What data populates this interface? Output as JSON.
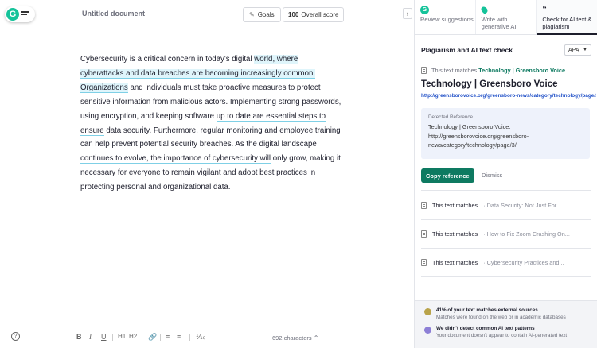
{
  "editor": {
    "doc_title": "Untitled document",
    "goals_label": "Goals",
    "score_value": "100",
    "score_label": "Overall score",
    "paragraph": [
      {
        "t": "Cybersecurity is a critical concern in today's digital ",
        "s": "n"
      },
      {
        "t": "world, where cyberattacks and data breaches are becoming increasingly common. Organizations",
        "s": "h"
      },
      {
        "t": " and individuals must take proactive measures to protect sensitive information from malicious actors. Implementing strong passwords, using encryption, and keeping software ",
        "s": "n"
      },
      {
        "t": "up to date are essential steps to ensure",
        "s": "u"
      },
      {
        "t": " data security. Furthermore, regular monitoring and employee training can help prevent potential security breaches. ",
        "s": "n"
      },
      {
        "t": "As the digital landscape continues to evolve, the importance of cybersecurity will",
        "s": "u"
      },
      {
        "t": " only grow, making it necessary for everyone to remain vigilant and adopt best practices in protecting personal and organizational data.",
        "s": "n"
      }
    ],
    "toolbar": {
      "bold": "B",
      "italic": "I",
      "underline": "U",
      "h1": "H1",
      "h2": "H2",
      "help": "?",
      "char_count": "692 characters"
    }
  },
  "panel": {
    "tabs": [
      {
        "label": "Review suggestions",
        "icon": "grammarly-icon"
      },
      {
        "label": "Write with generative AI",
        "icon": "pin-icon"
      },
      {
        "label": "Check for AI text & plagiarism",
        "icon": "quote-icon"
      }
    ],
    "title": "Plagiarism and AI text check",
    "citation_style": "APA",
    "match_prefix": "This text matches",
    "match_source": "Technology | Greensboro Voice",
    "source_title": "Technology | Greensboro Voice",
    "source_url": "http://greensborovoice.org/greensboro-news/category/technology/page/3/",
    "ref_label": "Detected Reference",
    "ref_text": "Technology | Greensboro Voice. http://greensborovoice.org/greensboro-news/category/technology/page/3/",
    "copy_label": "Copy reference",
    "dismiss_label": "Dismiss",
    "matches": [
      {
        "label": "This text matches",
        "source": "· Data Security: Not Just For..."
      },
      {
        "label": "This text matches",
        "source": "· How to Fix Zoom Crashing On..."
      },
      {
        "label": "This text matches",
        "source": "· Cybersecurity Practices and..."
      }
    ],
    "footer": {
      "plag_title": "41% of your text matches external sources",
      "plag_sub": "Matches were found on the web or in academic databases",
      "ai_title": "We didn't detect common AI text patterns",
      "ai_sub": "Your document doesn't appear to contain AI-generated text"
    }
  },
  "colors": {
    "brand": "#15c39a",
    "accent_dark": "#0e7a61",
    "link": "#1f4fc7",
    "highlight": "#dff5fb"
  }
}
